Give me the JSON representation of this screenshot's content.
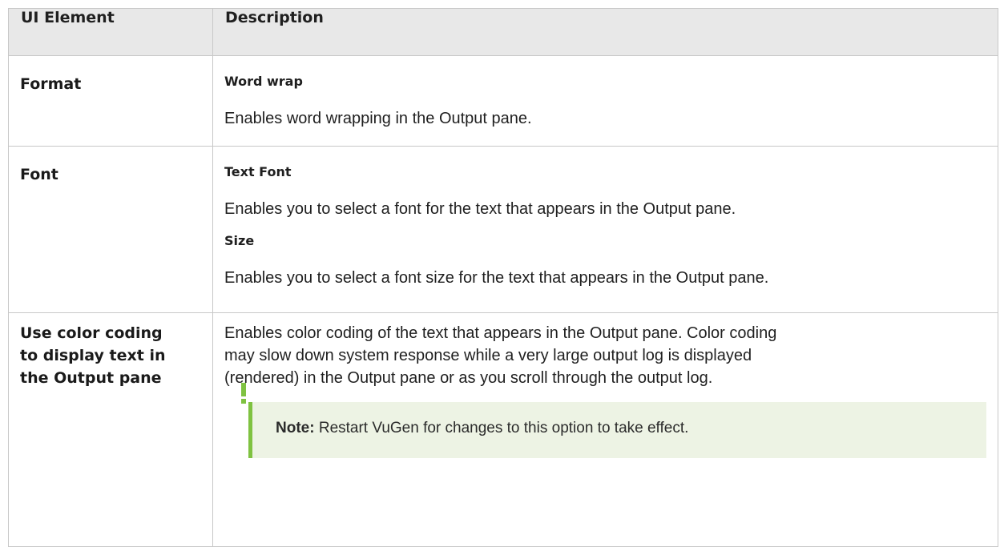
{
  "headers": {
    "ui_element": "UI Element",
    "description": "Description"
  },
  "rows": [
    {
      "element": "Format",
      "items": [
        {
          "title": "Word wrap",
          "text": "Enables word wrapping in the Output pane."
        }
      ]
    },
    {
      "element": "Font",
      "items": [
        {
          "title": "Text Font",
          "text": "Enables you to select a font for the text that appears in the Output pane."
        },
        {
          "title": "Size",
          "text": "Enables you to select a font size for the text that appears in the Output pane."
        }
      ]
    },
    {
      "element_lines": [
        "Use color coding",
        "to display text in",
        "the Output pane"
      ],
      "text_lines": [
        "Enables color coding of the text that appears in the Output pane. Color coding",
        "may slow down system response while a very large output log is displayed",
        "(rendered) in the Output pane or as you scroll through the output log."
      ],
      "note": {
        "label": "Note:",
        "text": " Restart VuGen for changes to this option to take effect."
      }
    }
  ],
  "colors": {
    "header_bg": "#e8e8e8",
    "border": "#c8c8c8",
    "note_bg": "#edf3e4",
    "note_accent": "#7fc241"
  },
  "icons": {
    "note": "exclamation-icon"
  }
}
